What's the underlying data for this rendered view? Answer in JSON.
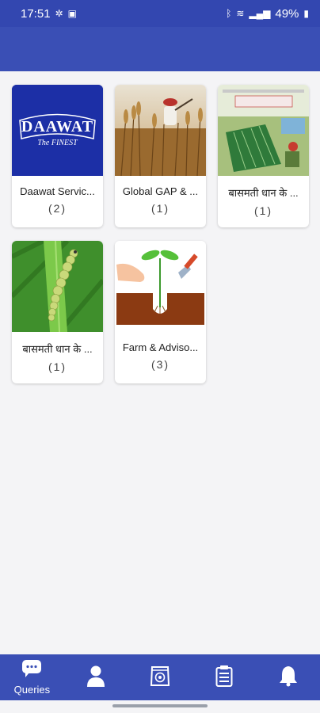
{
  "status_bar": {
    "time": "17:51",
    "battery": "49%"
  },
  "cards": [
    {
      "title": "Daawat Servic...",
      "count": "(2)",
      "thumb": "daawat-logo"
    },
    {
      "title": "Global GAP & ...",
      "count": "(1)",
      "thumb": "wheat-field"
    },
    {
      "title": "बासमती धान के ...",
      "count": "(1)",
      "thumb": "booklet-cover"
    },
    {
      "title": "बासमती धान के ...",
      "count": "(1)",
      "thumb": "caterpillar"
    },
    {
      "title": "Farm & Adviso...",
      "count": "(3)",
      "thumb": "seedling-planting"
    }
  ],
  "thumb_texts": {
    "daawat_brand": "DAAWAT",
    "daawat_tagline": "The FINEST"
  },
  "bottom_nav": [
    {
      "label": "Queries",
      "icon": "chat-icon",
      "active": true
    },
    {
      "label": "",
      "icon": "person-icon",
      "active": false
    },
    {
      "label": "",
      "icon": "seed-bag-icon",
      "active": false
    },
    {
      "label": "",
      "icon": "clipboard-icon",
      "active": false
    },
    {
      "label": "",
      "icon": "bell-icon",
      "active": false
    }
  ],
  "colors": {
    "primary": "#3a4fb5",
    "status_bar": "#3347b0",
    "background": "#f4f4f6"
  }
}
